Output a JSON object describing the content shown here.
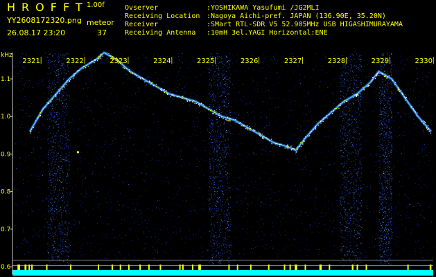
{
  "header": {
    "app_title": "HROFFT",
    "version": "1.00f",
    "filename": "YY2608172320.png",
    "datetime": "26.08.17 23:20",
    "meteor_label": "meteor",
    "meteor_count": "37"
  },
  "info": [
    {
      "label": "Ovserver",
      "value": ":YOSHIKAWA Yasufumi /JG2MLI"
    },
    {
      "label": "Receiving Location",
      "value": ":Nagoya Aichi-pref. JAPAN (136.90E, 35.20N)"
    },
    {
      "label": "Receiver",
      "value": ":SMart RTL-SDR V5 52.905MHz USB HIGASHIMURAYAMA"
    },
    {
      "label": "Receiving Antenna",
      "value": ":10mH 3el.YAGI Horizontal:ENE"
    }
  ],
  "chart_data": {
    "type": "heatmap",
    "ylabel": "kHz",
    "yticks": [
      "1.1",
      "1.0",
      "0.9",
      "0.8",
      "0.7",
      "0.6"
    ],
    "ylim": [
      0.58,
      1.17
    ],
    "time_labels": [
      "2321",
      "2322",
      "2323",
      "2324",
      "2325",
      "2326",
      "2327",
      "2328",
      "2329",
      "2330"
    ],
    "time_range": [
      2321,
      2330
    ],
    "trace": [
      {
        "t": 2321.0,
        "f": 0.96
      },
      {
        "t": 2321.3,
        "f": 1.02
      },
      {
        "t": 2321.6,
        "f": 1.06
      },
      {
        "t": 2321.9,
        "f": 1.1
      },
      {
        "t": 2322.2,
        "f": 1.13
      },
      {
        "t": 2322.5,
        "f": 1.15
      },
      {
        "t": 2322.7,
        "f": 1.17
      },
      {
        "t": 2323.0,
        "f": 1.15
      },
      {
        "t": 2323.3,
        "f": 1.12
      },
      {
        "t": 2323.6,
        "f": 1.1
      },
      {
        "t": 2323.9,
        "f": 1.08
      },
      {
        "t": 2324.2,
        "f": 1.06
      },
      {
        "t": 2324.5,
        "f": 1.05
      },
      {
        "t": 2324.8,
        "f": 1.04
      },
      {
        "t": 2325.1,
        "f": 1.02
      },
      {
        "t": 2325.4,
        "f": 1.0
      },
      {
        "t": 2325.7,
        "f": 0.99
      },
      {
        "t": 2326.0,
        "f": 0.97
      },
      {
        "t": 2326.3,
        "f": 0.95
      },
      {
        "t": 2326.6,
        "f": 0.93
      },
      {
        "t": 2326.9,
        "f": 0.92
      },
      {
        "t": 2327.1,
        "f": 0.91
      },
      {
        "t": 2327.3,
        "f": 0.94
      },
      {
        "t": 2327.6,
        "f": 0.98
      },
      {
        "t": 2327.9,
        "f": 1.01
      },
      {
        "t": 2328.2,
        "f": 1.04
      },
      {
        "t": 2328.5,
        "f": 1.06
      },
      {
        "t": 2328.8,
        "f": 1.09
      },
      {
        "t": 2329.0,
        "f": 1.12
      },
      {
        "t": 2329.3,
        "f": 1.1
      },
      {
        "t": 2329.6,
        "f": 1.05
      },
      {
        "t": 2329.9,
        "f": 1.0
      },
      {
        "t": 2330.2,
        "f": 0.96
      }
    ],
    "noise_bands": [
      [
        2321.4,
        2321.9
      ],
      [
        2325.1,
        2325.6
      ],
      [
        2328.1,
        2328.6
      ],
      [
        2329.0,
        2329.3
      ]
    ],
    "colors": {
      "background": "#000000",
      "noise": "#1e3cff",
      "trace": "#ffff00",
      "text": "#ffff00",
      "grid": "#ffffff",
      "meter": "#00ffff"
    }
  }
}
